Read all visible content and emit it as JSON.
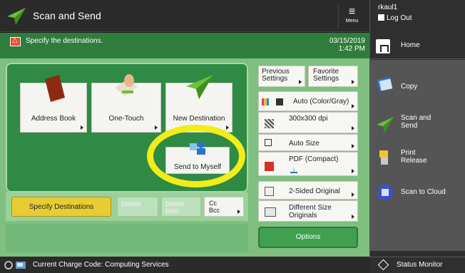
{
  "app": {
    "title": "Scan and Send",
    "menu_label": "Menu"
  },
  "user": {
    "name": "rkaul1",
    "logout": "Log Out"
  },
  "message": {
    "text": "Specify the destinations.",
    "date": "03/15/2019",
    "time": "1:42 PM"
  },
  "destinations": {
    "tiles": [
      {
        "label": "Address Book"
      },
      {
        "label": "One-Touch"
      },
      {
        "label": "New Destination"
      },
      {
        "label": "Send to Myself"
      }
    ],
    "buttons": {
      "specify": "Specify Destinations",
      "details": "Details",
      "delete_line1": "Delete",
      "delete_line2": "Dest.",
      "cc_line1": "Cc",
      "cc_line2": "Bcc"
    }
  },
  "settings": {
    "previous_line1": "Previous",
    "previous_line2": "Settings",
    "favorite_line1": "Favorite",
    "favorite_line2": "Settings",
    "color": "Auto (Color/Gray)",
    "resolution": "300x300 dpi",
    "size": "Auto Size",
    "format": "PDF (Compact)",
    "sides": "2-Sided Original",
    "different_line1": "Different Size",
    "different_line2": "Originals",
    "options": "Options"
  },
  "sidebar": {
    "home": "Home",
    "items": [
      {
        "line1": "Copy",
        "line2": ""
      },
      {
        "line1": "Scan and",
        "line2": "Send"
      },
      {
        "line1": "Print",
        "line2": "Release"
      },
      {
        "line1": "Scan to Cloud",
        "line2": ""
      }
    ],
    "status_monitor": "Status Monitor"
  },
  "status_bar": {
    "charge": "Current Charge Code: Computing Services"
  },
  "colors": {
    "accent_green": "#2e7d3c",
    "highlight_yellow": "#f1ec1a",
    "specify_yellow": "#e8cc34"
  }
}
